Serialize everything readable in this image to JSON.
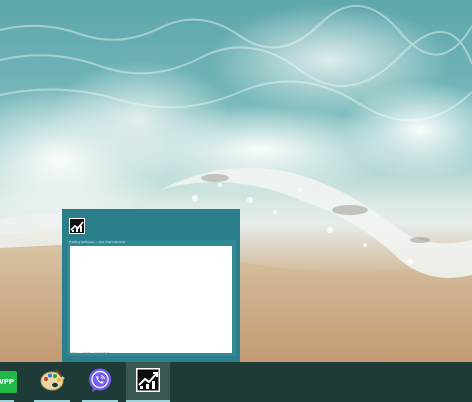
{
  "desktop": {
    "wallpaper": "ocean-wave-on-beach"
  },
  "taskbar": {
    "background": "#1f3b38",
    "indicator_color": "#9fd3d9",
    "items": [
      {
        "name": "wpp-app",
        "icon_text": "WPP",
        "icon_color": "#21b84a",
        "running": true,
        "active": false
      },
      {
        "name": "paint-app",
        "icon": "palette-icon",
        "running": true,
        "active": false
      },
      {
        "name": "viber-app",
        "icon": "viber-icon",
        "icon_color": "#7360f2",
        "running": true,
        "active": false
      },
      {
        "name": "stock-chart-app",
        "icon": "stock-chart-icon",
        "running": true,
        "active": true
      }
    ]
  },
  "thumbnail": {
    "background": "#2a7f8b",
    "app_icon": "stock-chart-icon",
    "caption": "Trading software — live chart window",
    "footer": "status · ready · connected"
  }
}
